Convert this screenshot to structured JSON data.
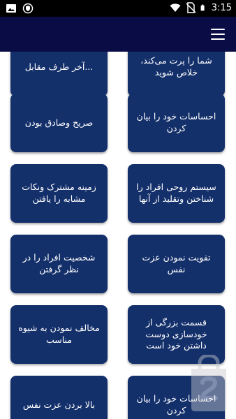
{
  "status_bar": {
    "time": "3:15",
    "icons": [
      "image-icon",
      "shield-icon",
      "wifi-icon",
      "no-sim-icon",
      "battery-icon"
    ]
  },
  "app_bar": {
    "menu_icon": "hamburger-menu-icon"
  },
  "cards": [
    {
      "right": "شما را پرت می‌کند، خلاص شوید",
      "left": "...آخر طرف مقابل"
    },
    {
      "right": "احساسات خود را بیان کردن",
      "left": "صریح وصادق بودن"
    },
    {
      "right": "سیستم روحی افراد را شناختن وتقلید از آنها",
      "left": "زمینه مشترک ونکات مشابه را یافتن"
    },
    {
      "right": "تقویت نمودن عزت نفس",
      "left": "شخصیت افراد را در نظر گرفتن"
    },
    {
      "right": "قسمت بزرگی از خودسازی دوست داشتن خود است",
      "left": "مخالف نمودن به شیوه مناسب"
    },
    {
      "right": "احساسات خود را بیان کردن",
      "left": "بالا بردن عزت نفس"
    }
  ],
  "colors": {
    "app_bar": "#0a0d45",
    "card": "#14306b",
    "status_bar": "#000000"
  }
}
